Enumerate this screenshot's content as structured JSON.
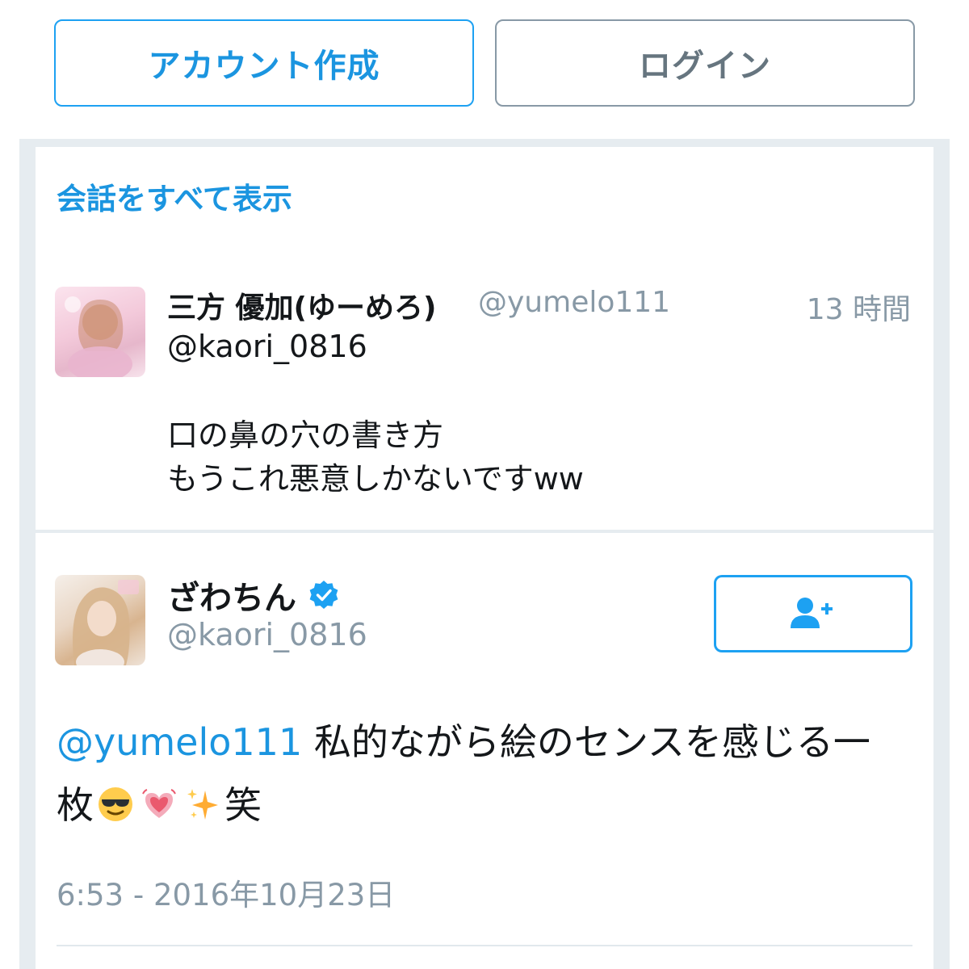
{
  "auth_buttons": {
    "signup_label": "アカウント作成",
    "login_label": "ログイン"
  },
  "conversation": {
    "view_all_label": "会話をすべて表示"
  },
  "reply_tweet": {
    "display_name": "三方 優加(ゆーめろ)",
    "handle": "@yumelo111",
    "time_ago": "13 時間",
    "replying_to": "@kaori_0816",
    "text_line1": "口の鼻の穴の書き方",
    "text_line2": "もうこれ悪意しかないですww"
  },
  "main_tweet": {
    "display_name": "ざわちん",
    "verified": true,
    "handle": "@kaori_0816",
    "mention": "@yumelo111",
    "text_part1": " 私的ながら絵のセンスを感じる一枚",
    "text_part2": "笑",
    "emojis": [
      "smiling-face-with-sunglasses",
      "beating-heart",
      "sparkles"
    ],
    "timestamp": "6:53 - 2016年10月23日",
    "follow_icon": "add-user-icon"
  },
  "colors": {
    "accent": "#1da1f2",
    "link": "#1b95e0",
    "muted": "#8899a6",
    "text": "#14171a",
    "background": "#e6ecf0"
  }
}
